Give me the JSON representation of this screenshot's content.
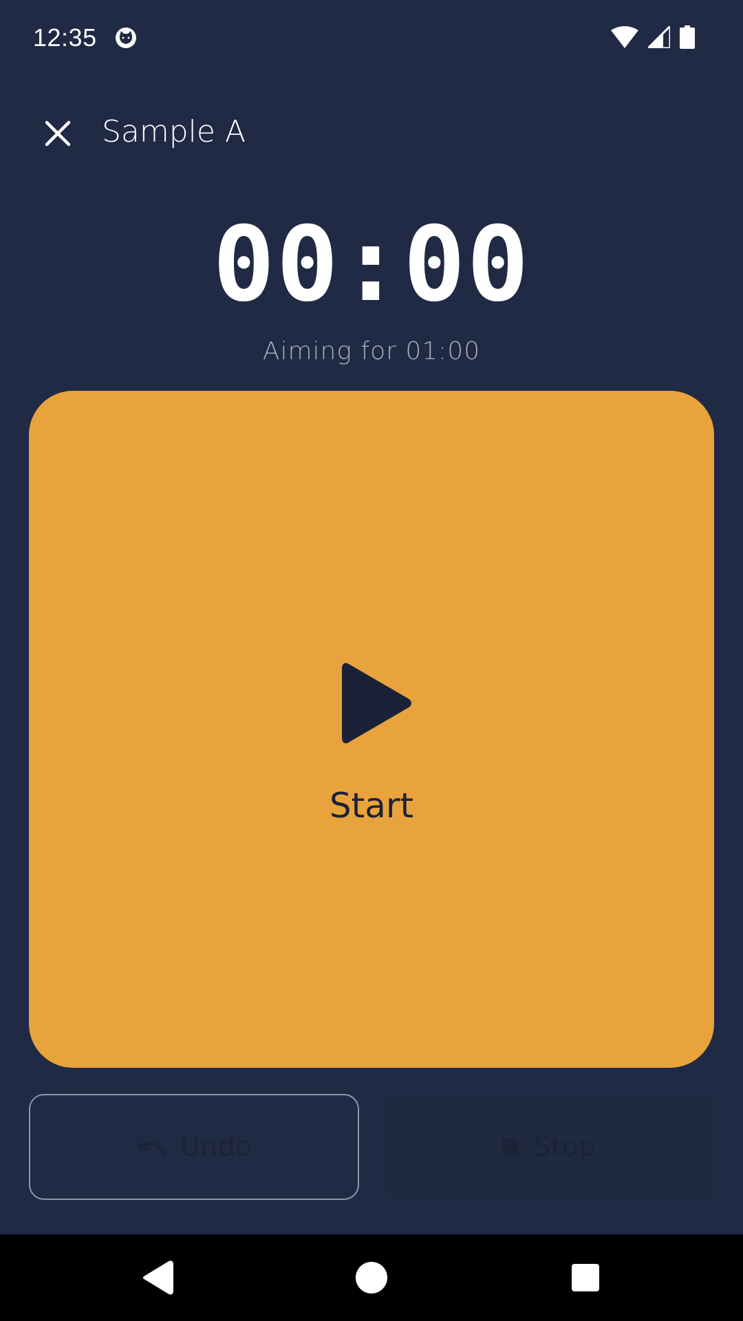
{
  "status_bar": {
    "time": "12:35",
    "icons": [
      "cat-app-icon",
      "wifi-icon",
      "cellular-signal-icon",
      "battery-icon"
    ]
  },
  "header": {
    "close_icon": "close-icon",
    "title": "Sample A"
  },
  "timer": {
    "elapsed": "00:00",
    "target_text": "Aiming for 01:00"
  },
  "start_card": {
    "icon": "play-icon",
    "label": "Start",
    "color": "#e8a33c"
  },
  "actions": {
    "undo": {
      "label": "Undo",
      "icon": "undo-icon",
      "enabled": false
    },
    "stop": {
      "label": "Stop",
      "icon": "stop-icon",
      "enabled": false
    }
  },
  "nav_bar": {
    "buttons": [
      "back-icon",
      "home-icon",
      "recents-icon"
    ]
  },
  "colors": {
    "background": "#202a44",
    "accent": "#e8a33c",
    "text_primary": "#ffffff",
    "text_secondary": "#a9afbd",
    "dark_text": "#1b2238"
  }
}
